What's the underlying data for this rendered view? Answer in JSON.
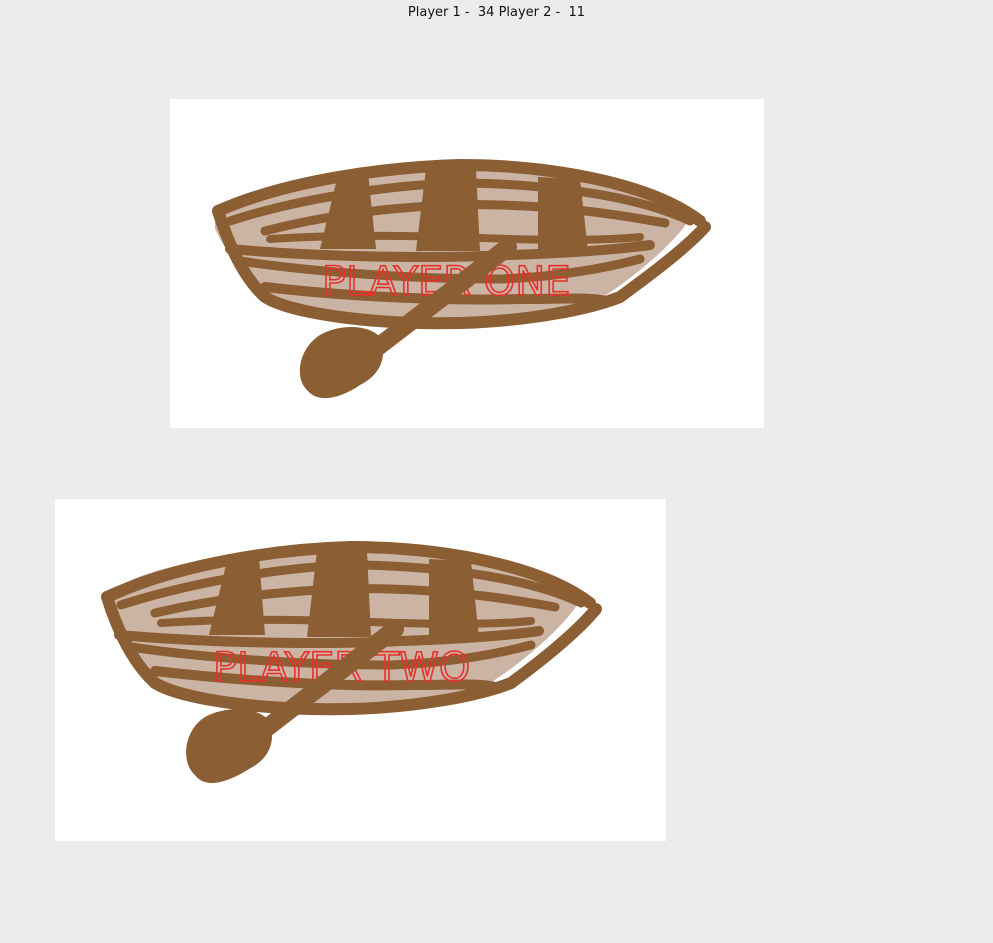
{
  "scoreboard": {
    "player1_label": "Player 1 -",
    "player1_score": "34",
    "player2_label": "Player 2 -",
    "player2_score": "11"
  },
  "boats": [
    {
      "label": "PLAYER ONE",
      "icon": "rowboat-with-oar-icon"
    },
    {
      "label": "PLAYER TWO",
      "icon": "rowboat-with-oar-icon"
    }
  ],
  "colors": {
    "background": "#ececec",
    "panel": "#ffffff",
    "boat_wood": "#8b5e34",
    "boat_light": "#cbb4a3",
    "label": "#e8302a"
  }
}
